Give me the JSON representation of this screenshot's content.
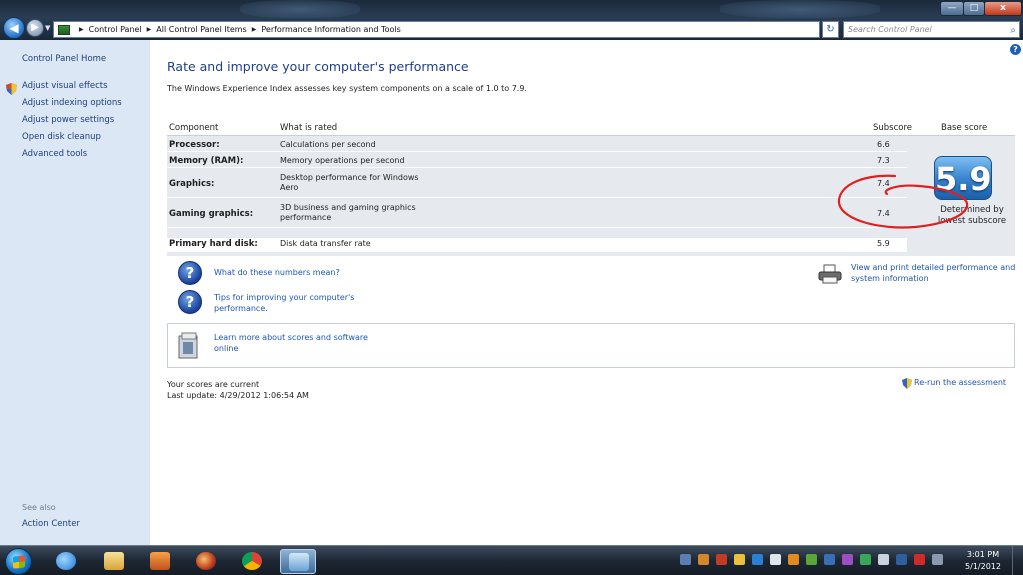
{
  "window": {
    "minimize": "—",
    "maximize": "□",
    "close": "x"
  },
  "address": {
    "crumbs": [
      "Control Panel",
      "All Control Panel Items",
      "Performance Information and Tools"
    ],
    "search_placeholder": "Search Control Panel"
  },
  "sidebar": {
    "home": "Control Panel Home",
    "items": [
      {
        "label": "Adjust visual effects"
      },
      {
        "label": "Adjust indexing options"
      },
      {
        "label": "Adjust power settings"
      },
      {
        "label": "Open disk cleanup"
      },
      {
        "label": "Advanced tools"
      }
    ],
    "see_also": "See also",
    "action_center": "Action Center"
  },
  "main": {
    "title": "Rate and improve your computer's performance",
    "intro": "The Windows Experience Index assesses key system components on a scale of 1.0 to 7.9.",
    "table": {
      "headers": {
        "component": "Component",
        "what": "What is rated",
        "subscore": "Subscore",
        "base": "Base score"
      },
      "rows": [
        {
          "component": "Processor:",
          "what": "Calculations per second",
          "subscore": "6.6"
        },
        {
          "component": "Memory (RAM):",
          "what": "Memory operations per second",
          "subscore": "7.3"
        },
        {
          "component": "Graphics:",
          "what": "Desktop performance for Windows Aero",
          "subscore": "7.4"
        },
        {
          "component": "Gaming graphics:",
          "what": "3D business and gaming graphics performance",
          "subscore": "7.4"
        },
        {
          "component": "Primary hard disk:",
          "what": "Disk data transfer rate",
          "subscore": "5.9"
        }
      ],
      "base_score": "5.9",
      "determined_by": "Determined by lowest subscore"
    },
    "links": {
      "numbers_mean": "What do these numbers mean?",
      "tips": "Tips for improving your computer's performance.",
      "view_print": "View and print detailed performance and system information",
      "learn_more": "Learn more about scores and software online"
    },
    "status": {
      "current": "Your scores are current",
      "last_update": "Last update: 4/29/2012 1:06:54 AM",
      "rerun": "Re-run the assessment"
    }
  },
  "taskbar": {
    "time": "3:01 PM",
    "date": "5/1/2012"
  },
  "colors": {
    "accent": "#1e3f8a",
    "link": "#1f55b3",
    "sidebar": "#dbe7f5",
    "annotation": "#e02020"
  }
}
